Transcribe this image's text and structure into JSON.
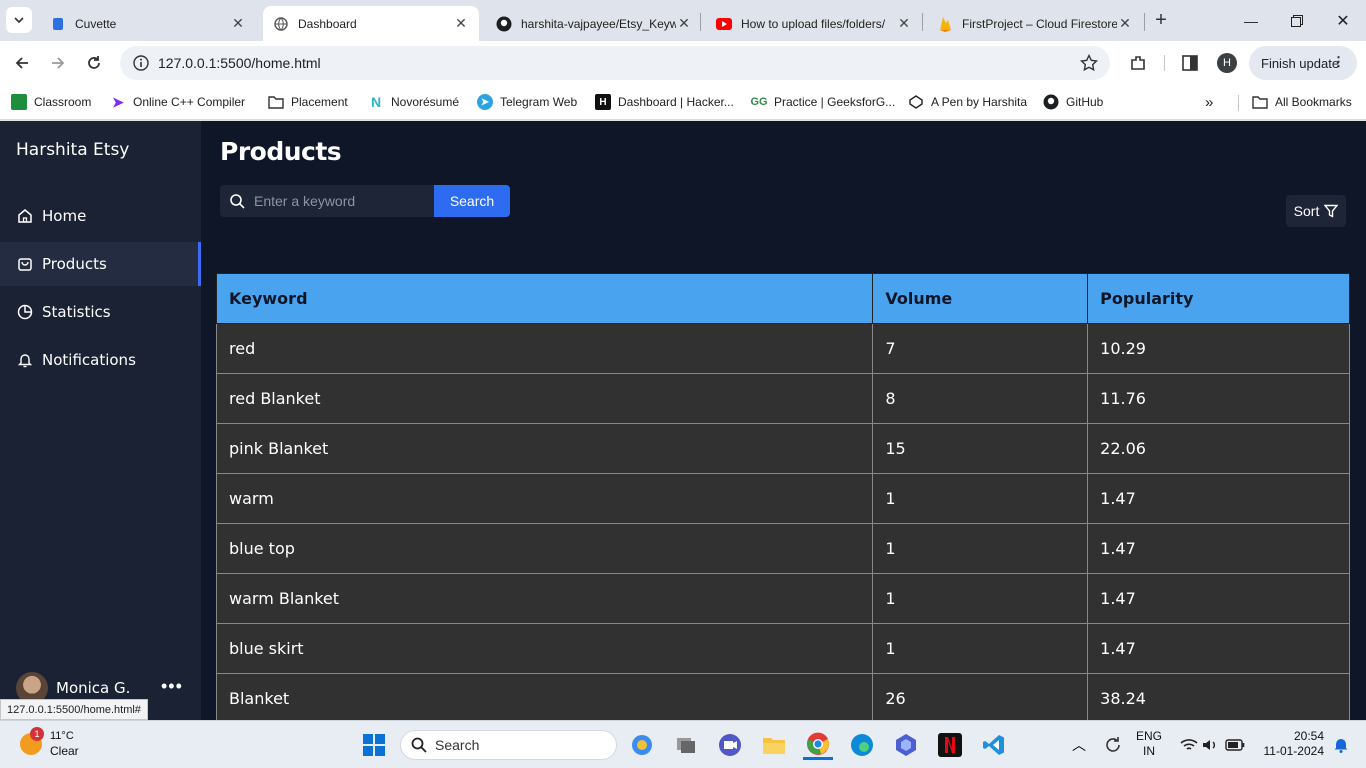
{
  "browser": {
    "tabs": [
      {
        "title": "Cuvette",
        "icon": "cuvette-icon"
      },
      {
        "title": "Dashboard",
        "icon": "globe-icon",
        "active": true
      },
      {
        "title": "harshita-vajpayee/Etsy_Keyw",
        "icon": "github-icon"
      },
      {
        "title": "How to upload files/folders/",
        "icon": "youtube-icon"
      },
      {
        "title": "FirstProject – Cloud Firestore",
        "icon": "firebase-icon"
      }
    ],
    "url": "127.0.0.1:5500/home.html",
    "profile_initial": "H",
    "finish_update_label": "Finish update",
    "bookmarks": [
      "Classroom",
      "Online C++ Compiler",
      "Placement",
      "Novorésumé",
      "Telegram Web",
      "Dashboard | Hacker...",
      "Practice | GeeksforG...",
      "A Pen by Harshita",
      "GitHub"
    ],
    "all_bookmarks_label": "All Bookmarks",
    "status_url": "127.0.0.1:5500/home.html#"
  },
  "sidebar": {
    "brand": "Harshita Etsy",
    "items": [
      {
        "label": "Home",
        "icon": "home-icon"
      },
      {
        "label": "Products",
        "icon": "bag-icon",
        "active": true
      },
      {
        "label": "Statistics",
        "icon": "pie-chart-icon"
      },
      {
        "label": "Notifications",
        "icon": "bell-icon"
      }
    ],
    "user_name": "Monica G."
  },
  "main": {
    "title": "Products",
    "search": {
      "placeholder": "Enter a keyword",
      "button_label": "Search"
    },
    "sort_label": "Sort",
    "table": {
      "headers": [
        "Keyword",
        "Volume",
        "Popularity"
      ],
      "rows": [
        [
          "red",
          "7",
          "10.29"
        ],
        [
          "red Blanket",
          "8",
          "11.76"
        ],
        [
          "pink Blanket",
          "15",
          "22.06"
        ],
        [
          "warm",
          "1",
          "1.47"
        ],
        [
          "blue top",
          "1",
          "1.47"
        ],
        [
          "warm Blanket",
          "1",
          "1.47"
        ],
        [
          "blue skirt",
          "1",
          "1.47"
        ],
        [
          "Blanket",
          "26",
          "38.24"
        ]
      ]
    }
  },
  "taskbar": {
    "weather_temp": "11°C",
    "weather_desc": "Clear",
    "weather_badge": "1",
    "search_placeholder": "Search",
    "lang_top": "ENG",
    "lang_bottom": "IN",
    "time": "20:54",
    "date": "11-01-2024"
  },
  "colors": {
    "accent": "#3b6cf6",
    "table_header": "#4aa3ef",
    "app_bg": "#0f1627",
    "sidebar_bg": "#1b2234"
  }
}
